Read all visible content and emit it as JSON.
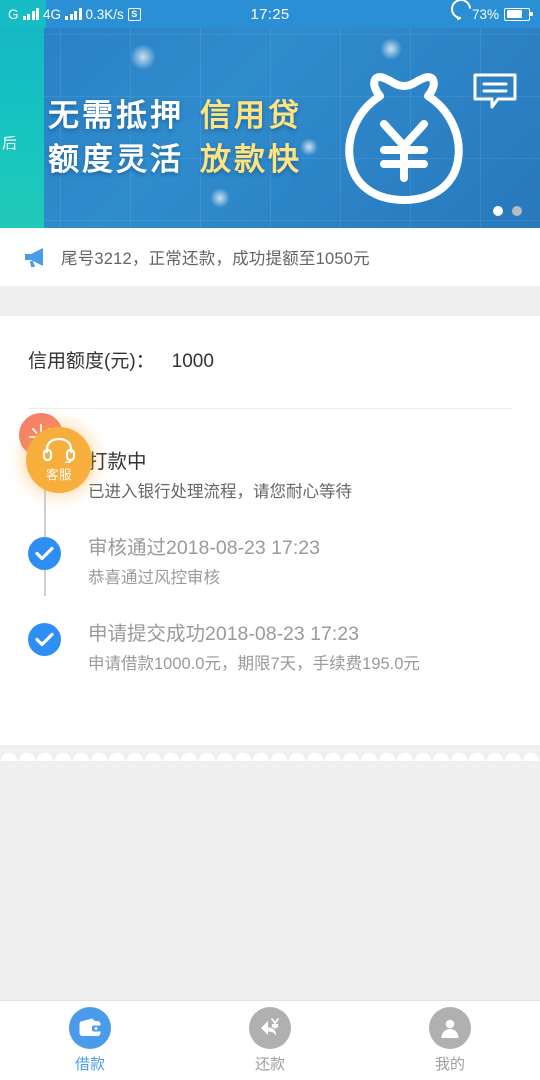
{
  "status_bar": {
    "network_type_1": "G",
    "network_type_2": "4G",
    "data_rate": "0.3K/s",
    "app_badge": "S",
    "time": "17:25",
    "battery_percent": "73%",
    "battery_level": 73,
    "icons": [
      "signal-bars-icon",
      "signal-bars-icon",
      "sync-icon",
      "wifi-icon",
      "battery-icon"
    ],
    "bg_color": "#2a8fd4"
  },
  "banner": {
    "line1_white": "无需抵押",
    "line1_yellow": "信用贷",
    "line2_white": "额度灵活",
    "line2_yellow": "放款快",
    "prev_slide_text": "后",
    "currency_symbol": "¥",
    "dots": [
      {
        "active": true
      },
      {
        "active": false
      }
    ],
    "colors": {
      "bg_start": "#2a7fc4",
      "bg_end": "#2878bd",
      "prev_slide": "#17c5c0",
      "highlight_text": "#ffe37e"
    }
  },
  "notice": {
    "text": "尾号3212，正常还款，成功提额至1050元",
    "icon": "megaphone-icon",
    "icon_color": "#4a9ceb"
  },
  "credit": {
    "label": "信用额度(元)：",
    "value": "1000"
  },
  "customer_service": {
    "label": "客服",
    "icon": "headset-icon",
    "color": "#f8ae3c",
    "badge_color": "#f4806a"
  },
  "timeline": [
    {
      "title": "打款中",
      "subtitle": "已进入银行处理流程，请您耐心等待",
      "state": "active",
      "has_check": false
    },
    {
      "title": "审核通过2018-08-23 17:23",
      "subtitle": "恭喜通过风控审核",
      "state": "done",
      "has_check": true
    },
    {
      "title": "申请提交成功2018-08-23 17:23",
      "subtitle": "申请借款1000.0元，期限7天，手续费195.0元",
      "state": "done",
      "has_check": true
    }
  ],
  "tabbar": {
    "items": [
      {
        "label": "借款",
        "icon": "wallet-icon",
        "active": true
      },
      {
        "label": "还款",
        "icon": "repay-arrow-icon",
        "active": false
      },
      {
        "label": "我的",
        "icon": "person-icon",
        "active": false
      }
    ],
    "active_color": "#4a9ceb",
    "inactive_color": "#b0b0b0"
  }
}
